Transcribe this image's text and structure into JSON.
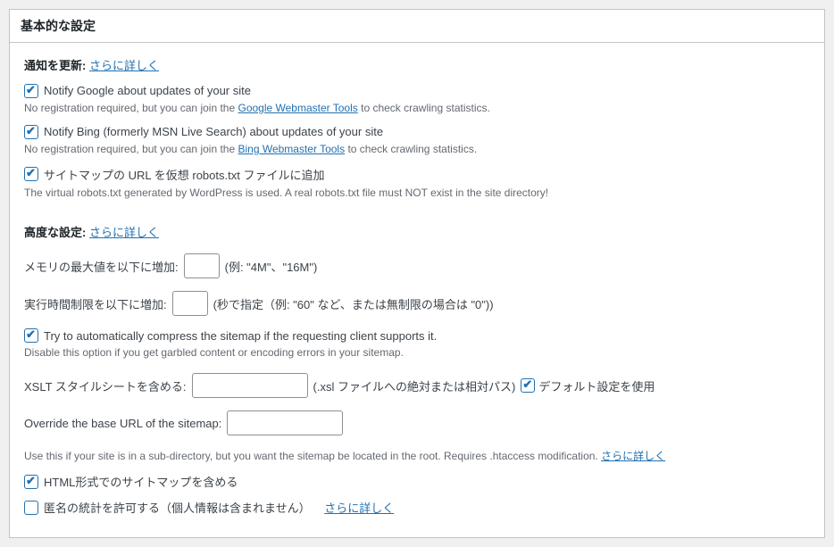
{
  "panel_title": "基本的な設定",
  "notify": {
    "group_label": "通知を更新:",
    "more_link": "さらに詳しく",
    "google": {
      "label": "Notify Google about updates of your site",
      "desc_pre": "No registration required, but you can join the ",
      "desc_link": "Google Webmaster Tools",
      "desc_post": " to check crawling statistics.",
      "checked": true
    },
    "bing": {
      "label": "Notify Bing (formerly MSN Live Search) about updates of your site",
      "desc_pre": "No registration required, but you can join the ",
      "desc_link": "Bing Webmaster Tools",
      "desc_post": " to check crawling statistics.",
      "checked": true
    },
    "robots": {
      "label": "サイトマップの URL を仮想 robots.txt ファイルに追加",
      "desc": "The virtual robots.txt generated by WordPress is used. A real robots.txt file must NOT exist in the site directory!",
      "checked": true
    }
  },
  "advanced": {
    "group_label": "高度な設定:",
    "more_link": "さらに詳しく",
    "memory": {
      "label": "メモリの最大値を以下に増加:",
      "value": "",
      "hint": "(例: \"4M\"、\"16M\")"
    },
    "time": {
      "label": "実行時間制限を以下に増加:",
      "value": "",
      "hint": "(秒で指定（例: \"60\" など、または無制限の場合は \"0\"))"
    },
    "compress": {
      "label": "Try to automatically compress the sitemap if the requesting client supports it.",
      "desc": "Disable this option if you get garbled content or encoding errors in your sitemap.",
      "checked": true
    },
    "xslt": {
      "label": "XSLT スタイルシートを含める:",
      "value": "",
      "hint": "(.xsl ファイルへの絶対または相対パス)",
      "default_label": "デフォルト設定を使用",
      "default_checked": true
    },
    "baseurl": {
      "label": "Override the base URL of the sitemap:",
      "value": "",
      "desc_pre": "Use this if your site is in a sub-directory, but you want the sitemap be located in the root. Requires .htaccess modification. ",
      "desc_link": "さらに詳しく"
    },
    "html": {
      "label": "HTML形式でのサイトマップを含める",
      "checked": true
    },
    "anon": {
      "label": "匿名の統計を許可する（個人情報は含まれません）",
      "more_link": "さらに詳しく",
      "checked": false
    }
  }
}
